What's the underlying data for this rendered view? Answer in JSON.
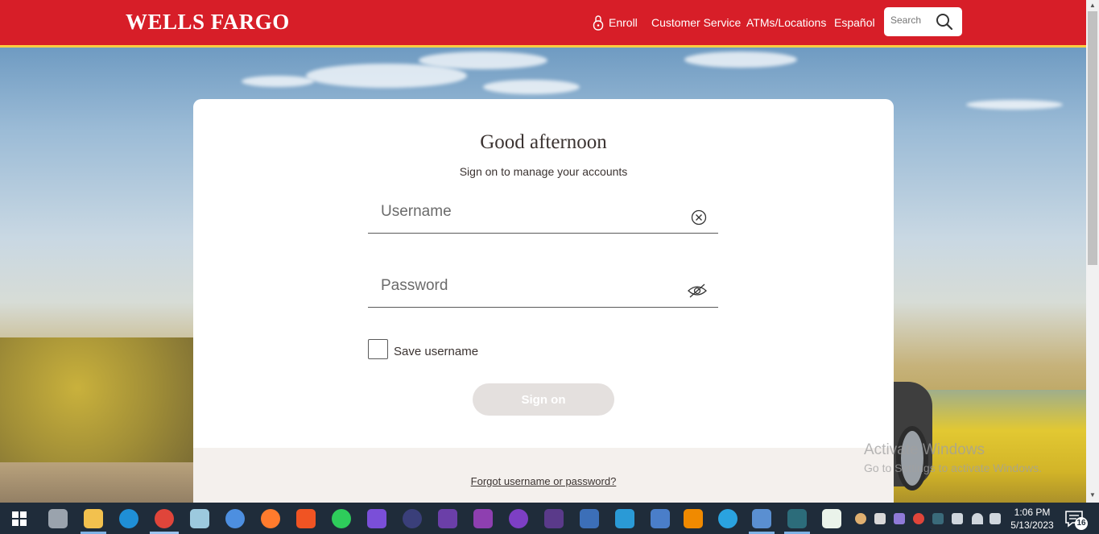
{
  "header": {
    "logo": "WELLS FARGO",
    "nav": {
      "enroll": "Enroll",
      "customer_service": "Customer Service",
      "atms": "ATMs/Locations",
      "espanol": "Español"
    },
    "search": {
      "placeholder": "Search",
      "icon": "search-icon"
    },
    "brand_red": "#d71e28",
    "accent_gold": "#ffcd41"
  },
  "login": {
    "greeting": "Good afternoon",
    "subtitle": "Sign on to manage your accounts",
    "username": {
      "placeholder": "Username",
      "value": "",
      "icon": "clear-icon"
    },
    "password": {
      "placeholder": "Password",
      "value": "",
      "icon": "hide-password-icon"
    },
    "save_username": {
      "label": "Save username",
      "checked": false
    },
    "sign_on": {
      "label": "Sign on",
      "enabled": false
    },
    "forgot": "Forgot username or password?"
  },
  "watermark": {
    "line1": "Activate Windows",
    "line2": "Go to Settings to activate Windows."
  },
  "taskbar": {
    "icons": [
      "windows-start-icon",
      "task-manager-icon",
      "file-explorer-icon",
      "edge-icon",
      "chrome-icon",
      "notepad-icon",
      "chromium-icon",
      "firefox-icon",
      "brave-icon",
      "whatsapp-icon",
      "app-d-icon",
      "app-ring-icon",
      "app-infinity-icon",
      "app-n-icon",
      "app-audio-icon",
      "app-bike-icon",
      "network-app-icon",
      "app-l-icon",
      "remote-desktop-icon",
      "vlc-icon",
      "telegram-icon",
      "virtualbox-icon",
      "nox-icon",
      "app-green-icon"
    ],
    "time": "1:06 PM",
    "date": "5/13/2023",
    "notification_count": "16"
  }
}
